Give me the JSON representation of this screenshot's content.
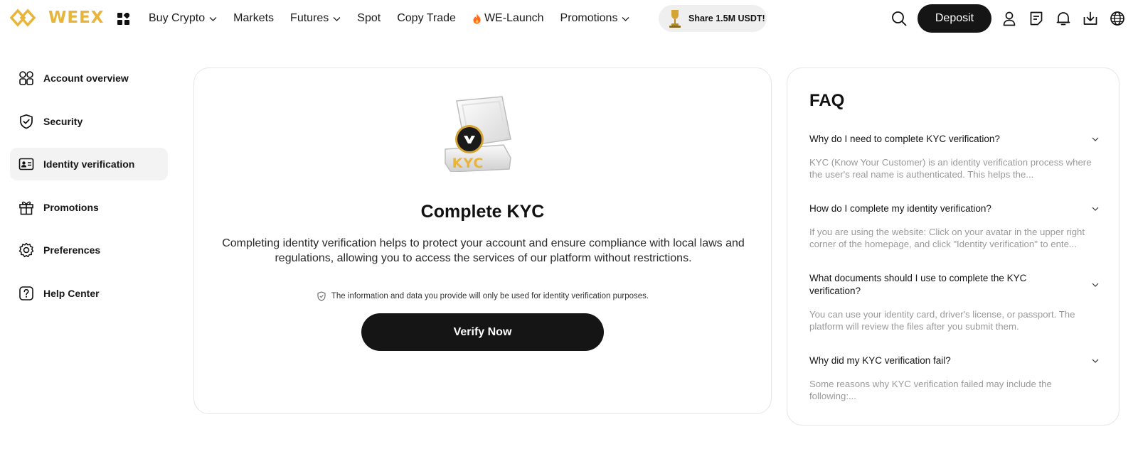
{
  "brand": {
    "name": "WEEX",
    "color": "#e8b53a"
  },
  "nav": {
    "items": [
      {
        "label": "Buy Crypto",
        "dropdown": true
      },
      {
        "label": "Markets",
        "dropdown": false
      },
      {
        "label": "Futures",
        "dropdown": true
      },
      {
        "label": "Spot",
        "dropdown": false
      },
      {
        "label": "Copy Trade",
        "dropdown": false
      },
      {
        "label": "WE-Launch",
        "dropdown": false,
        "icon": "fire-icon"
      },
      {
        "label": "Promotions",
        "dropdown": true
      }
    ],
    "share_pill": "Share 1.5M USDT!",
    "deposit_label": "Deposit"
  },
  "sidebar": {
    "items": [
      {
        "label": "Account overview",
        "icon": "grid-circles-icon",
        "active": false
      },
      {
        "label": "Security",
        "icon": "shield-check-icon",
        "active": false
      },
      {
        "label": "Identity verification",
        "icon": "id-card-icon",
        "active": true
      },
      {
        "label": "Promotions",
        "icon": "gift-icon",
        "active": false
      },
      {
        "label": "Preferences",
        "icon": "gear-icon",
        "active": false
      },
      {
        "label": "Help Center",
        "icon": "question-icon",
        "active": false
      }
    ]
  },
  "main": {
    "badge_text": "KYC",
    "title": "Complete KYC",
    "description": "Completing identity verification helps to protect your account and ensure compliance with local laws and regulations, allowing you to access the services of our platform without restrictions.",
    "note": "The information and data you provide will only be used for identity verification purposes.",
    "verify_label": "Verify Now"
  },
  "faq": {
    "title": "FAQ",
    "items": [
      {
        "question": "Why do I need to complete KYC verification?",
        "answer": "KYC (Know Your Customer) is an identity verification process where the user's real name is authenticated. This helps the..."
      },
      {
        "question": "How do I complete my identity verification?",
        "answer": "If you are using the website: Click on your avatar in the upper right corner of the homepage, and click \"Identity verification\" to ente..."
      },
      {
        "question": "What documents should I use to complete the KYC verification?",
        "answer": "You can use your identity card, driver's license, or passport. The platform will review the files after you submit them."
      },
      {
        "question": "Why did my KYC verification fail?",
        "answer": "Some reasons why KYC verification failed may include the following:..."
      }
    ]
  }
}
